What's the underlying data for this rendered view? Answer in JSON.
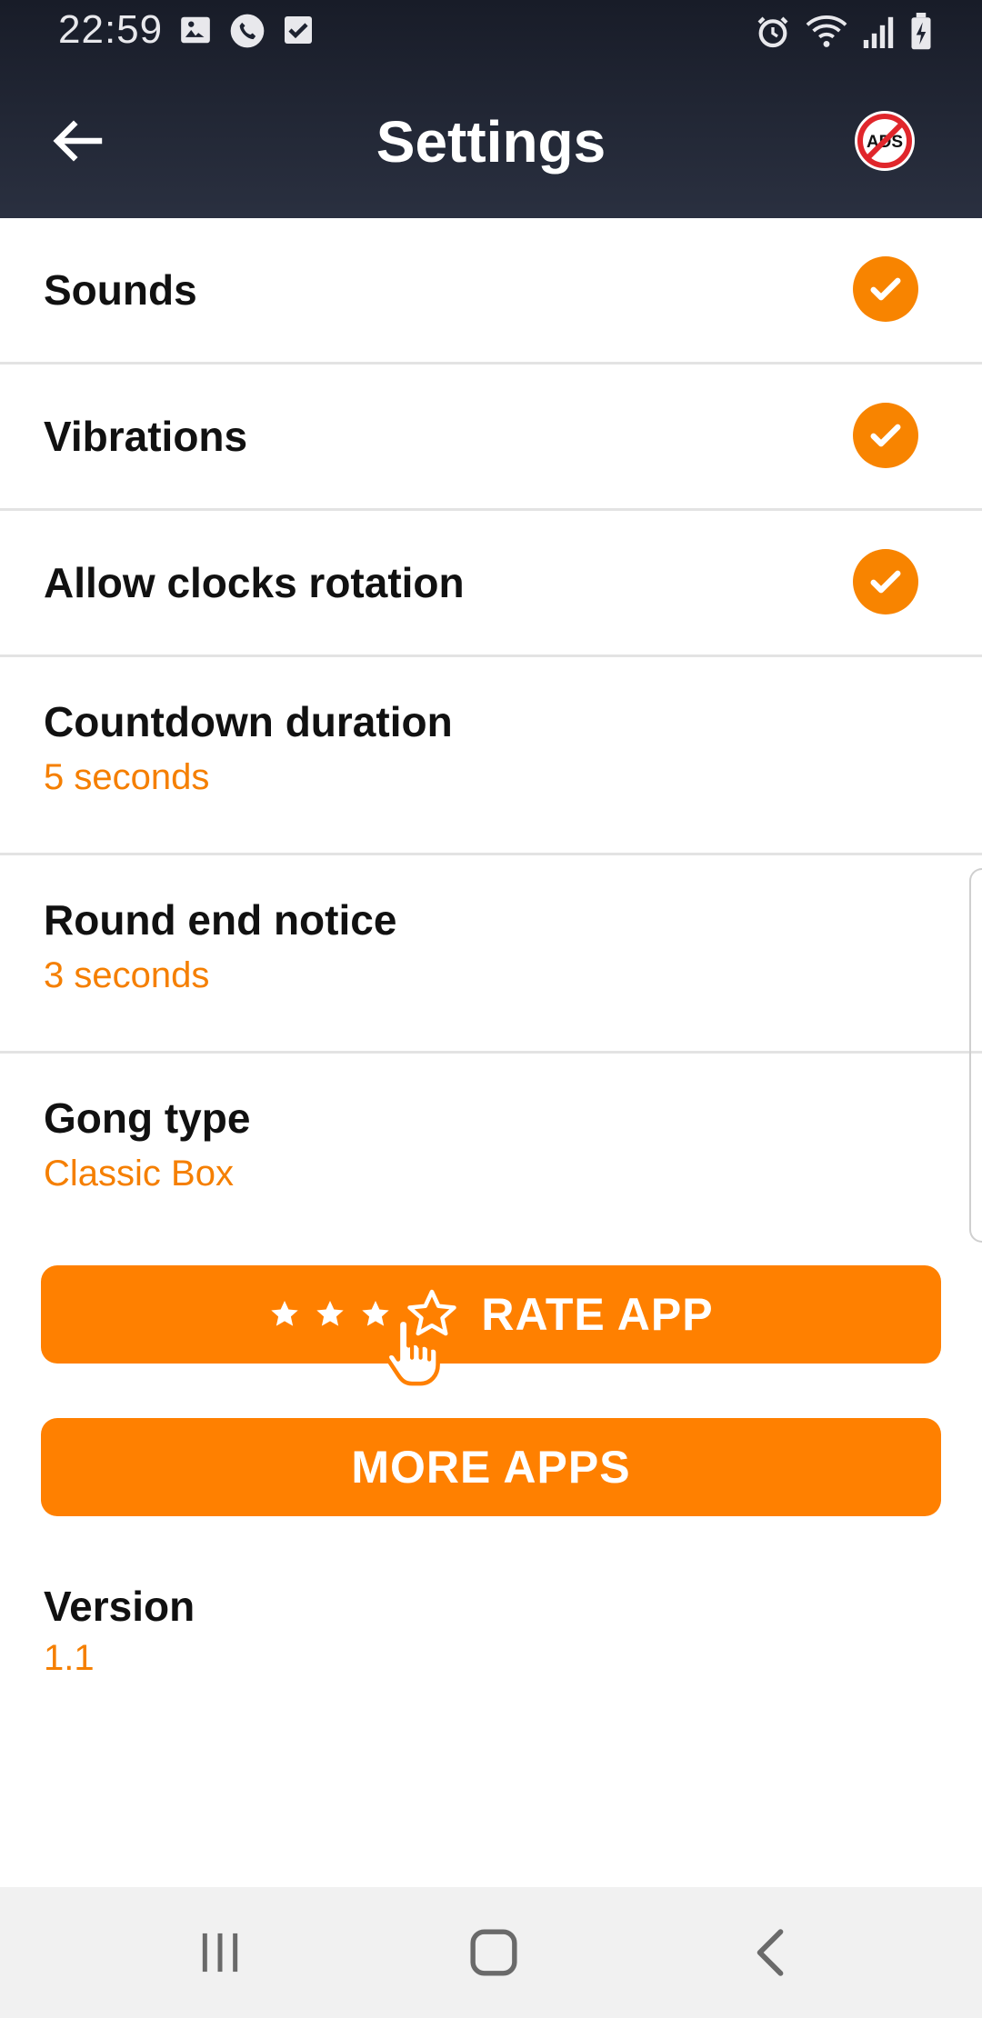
{
  "status_bar": {
    "time": "22:59",
    "left_icons": [
      "image-icon",
      "phone-icon",
      "checkbox-icon"
    ],
    "right_icons": [
      "alarm-icon",
      "wifi-icon",
      "signal-icon",
      "battery-charging-icon"
    ]
  },
  "toolbar": {
    "title": "Settings",
    "back_icon": "arrow-left-icon",
    "ads_icon": "no-ads-icon",
    "ads_label": "ADS"
  },
  "settings": {
    "sounds": {
      "label": "Sounds",
      "checked": true
    },
    "vibrations": {
      "label": "Vibrations",
      "checked": true
    },
    "rotation": {
      "label": "Allow clocks rotation",
      "checked": true
    },
    "countdown": {
      "label": "Countdown duration",
      "value": "5 seconds"
    },
    "round_end": {
      "label": "Round end notice",
      "value": "3 seconds"
    },
    "gong": {
      "label": "Gong type",
      "value": "Classic Box"
    }
  },
  "buttons": {
    "rate": "RATE APP",
    "more": "MORE APPS"
  },
  "version": {
    "label": "Version",
    "value": "1.1"
  },
  "colors": {
    "accent": "#ff8000",
    "header": "#1f2433",
    "value_text": "#f57f00"
  }
}
